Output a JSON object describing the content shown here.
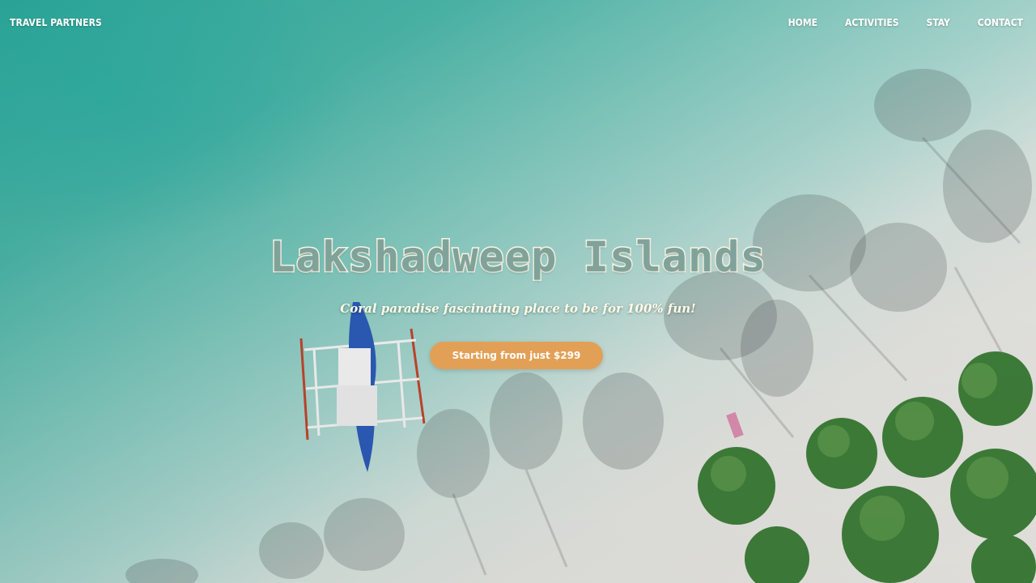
{
  "header": {
    "brand": "TRAVEL PARTNERS",
    "nav": [
      {
        "label": "HOME"
      },
      {
        "label": "ACTIVITIES"
      },
      {
        "label": "STAY"
      },
      {
        "label": "CONTACT"
      }
    ]
  },
  "hero": {
    "title": "Lakshadweep Islands",
    "subtitle": "Coral paradise fascinating place to be for 100% fun!",
    "cta_label": "Starting from just $299"
  },
  "colors": {
    "cta": "#e2a056",
    "title_fill": "#7fa39b",
    "title_outline": "#fbf6e6",
    "sea": "#2aa597",
    "sand": "#ecebe6"
  },
  "icons": {
    "boat": "outrigger-boat-icon",
    "palms": "palm-tree-shadow-icon"
  }
}
